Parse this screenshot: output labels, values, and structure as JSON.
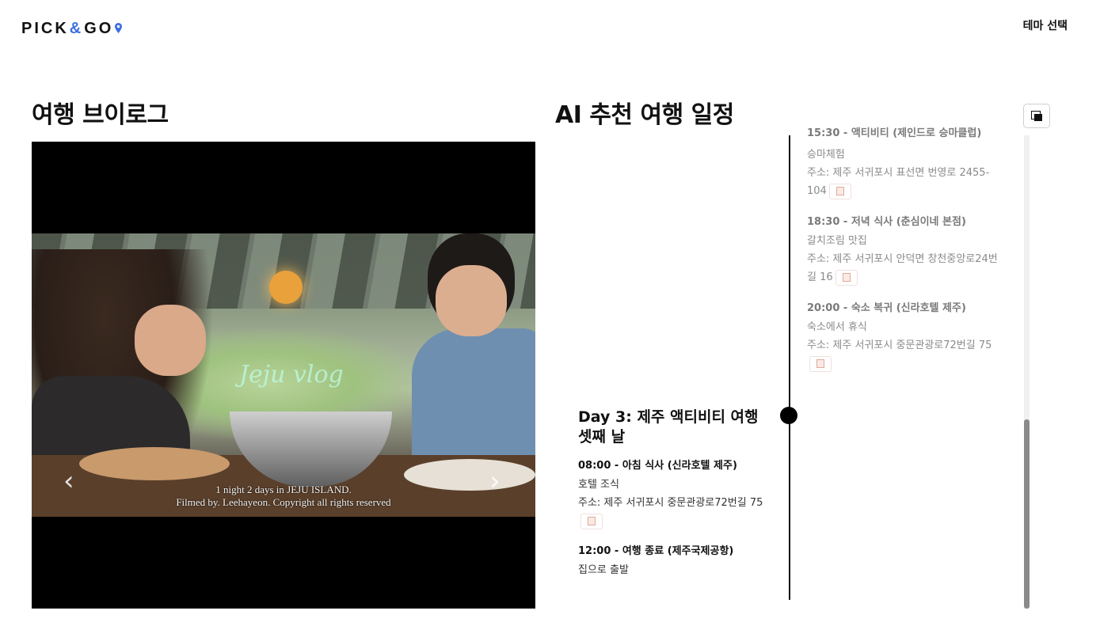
{
  "header": {
    "logo": {
      "part1": "PICK",
      "amp": "&",
      "part2": "GO"
    },
    "theme_link": "테마 선택"
  },
  "vlog": {
    "title": "여행 브이로그",
    "watermark": "Jeju vlog",
    "caption_line1": "1 night 2 days in JEJU ISLAND.",
    "caption_line2": "Filmed by. Leehayeon. Copyright all rights reserved",
    "prev_arrow": "‹",
    "next_arrow": "›"
  },
  "itinerary": {
    "title": "AI 추천 여행 일정",
    "day2_items": [
      {
        "time": "15:30 - 액티비티 (제인드로 승마클럽)",
        "desc": "승마체험",
        "address": "주소: 제주 서귀포시 표선면 번영로 2455-104"
      },
      {
        "time": "18:30 - 저녁 식사 (춘심이네 본점)",
        "desc": "갈치조림 맛집",
        "address": "주소: 제주 서귀포시 안덕면 창천중앙로24번길 16"
      },
      {
        "time": "20:00 - 숙소 복귀 (신라호텔 제주)",
        "desc": "숙소에서 휴식",
        "address": "주소: 제주 서귀포시 중문관광로72번길 75"
      }
    ],
    "day3": {
      "title": "Day 3: 제주 액티비티 여행 셋째 날",
      "items": [
        {
          "time": "08:00 - 아침 식사 (신라호텔 제주)",
          "desc": "호텔 조식",
          "address": "주소: 제주 서귀포시 중문관광로72번길 75"
        },
        {
          "time": "12:00 - 여행 종료 (제주국제공항)",
          "desc": "집으로 출발"
        }
      ]
    }
  },
  "colors": {
    "accent": "#3b6fe0",
    "text": "#111111",
    "muted": "#8a8a8a",
    "map_icon": "#e2a99a"
  },
  "icons": {
    "toggle": "window-toggle-icon",
    "map": "map-icon",
    "logo_pin": "location-pin-icon"
  },
  "scroll": {
    "position_fraction": 0.6
  }
}
